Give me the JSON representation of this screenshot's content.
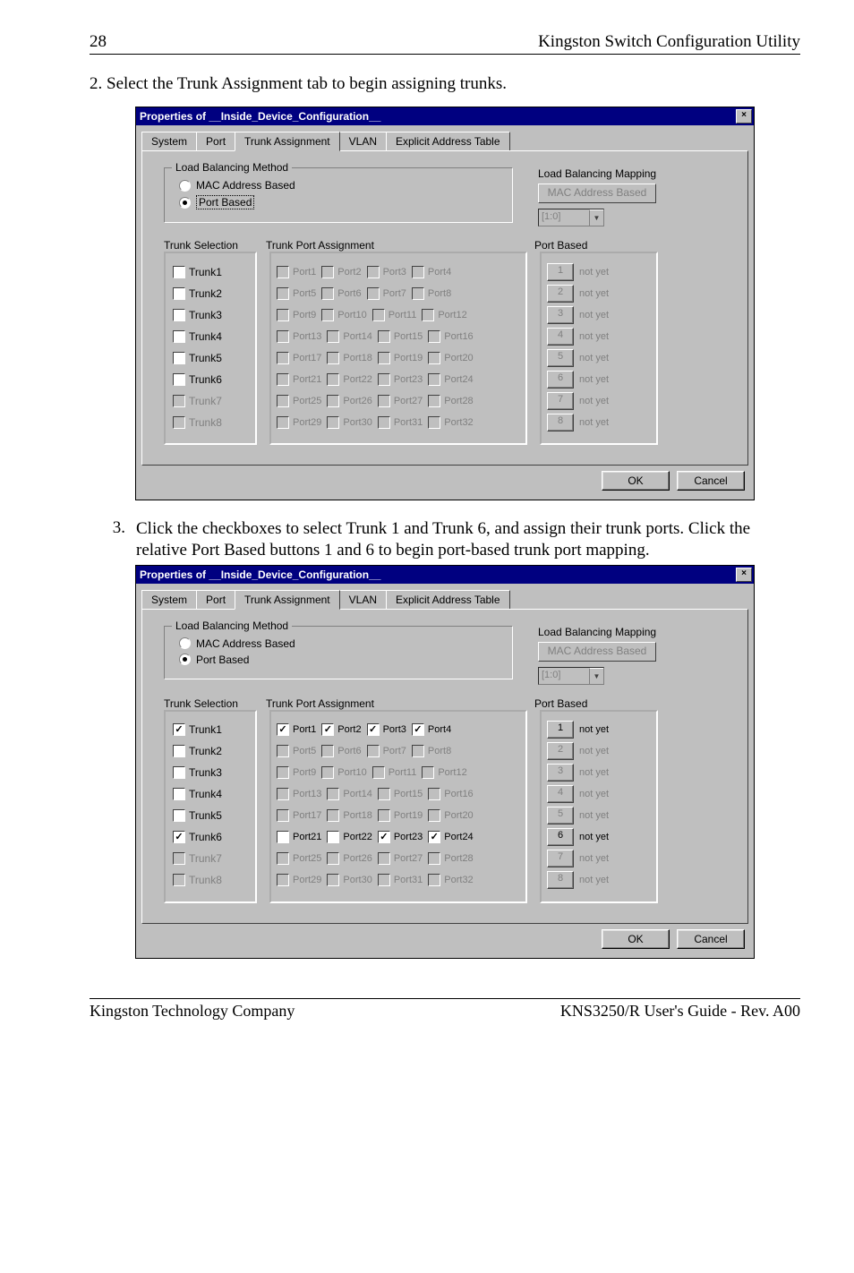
{
  "header": {
    "page_num": "28",
    "title": "Kingston Switch Configuration Utility"
  },
  "steps": {
    "s2": "2. Select the Trunk Assignment tab to begin assigning trunks.",
    "s3": "Click the checkboxes to select Trunk 1 and Trunk 6, and assign their trunk ports. Click the relative Port Based buttons 1 and 6 to begin port-based trunk port mapping.",
    "s3num": "3."
  },
  "dialog": {
    "title": "Properties of __Inside_Device_Configuration__",
    "close": "×",
    "tabs": {
      "system": "System",
      "port": "Port",
      "trunk": "Trunk Assignment",
      "vlan": "VLAN",
      "explicit": "Explicit Address Table"
    },
    "lb_group": "Load Balancing Method",
    "mac_radio": "MAC Address Based",
    "port_radio": "Port Based",
    "map_title": "Load Balancing Mapping",
    "mac_btn": "MAC Address Based",
    "combo_val": "[1:0]",
    "trunk_sel": "Trunk Selection",
    "tpa": "Trunk Port Assignment",
    "port_based_hdr": "Port Based",
    "not_yet": "not yet",
    "trunks": [
      "Trunk1",
      "Trunk2",
      "Trunk3",
      "Trunk4",
      "Trunk5",
      "Trunk6",
      "Trunk7",
      "Trunk8"
    ],
    "ports": [
      [
        "Port1",
        "Port2",
        "Port3",
        "Port4"
      ],
      [
        "Port5",
        "Port6",
        "Port7",
        "Port8"
      ],
      [
        "Port9",
        "Port10",
        "Port11",
        "Port12"
      ],
      [
        "Port13",
        "Port14",
        "Port15",
        "Port16"
      ],
      [
        "Port17",
        "Port18",
        "Port19",
        "Port20"
      ],
      [
        "Port21",
        "Port22",
        "Port23",
        "Port24"
      ],
      [
        "Port25",
        "Port26",
        "Port27",
        "Port28"
      ],
      [
        "Port29",
        "Port30",
        "Port31",
        "Port32"
      ]
    ],
    "pb_nums": [
      "1",
      "2",
      "3",
      "4",
      "5",
      "6",
      "7",
      "8"
    ],
    "ok": "OK",
    "cancel": "Cancel"
  },
  "d1": {
    "trunk_enabled": [
      true,
      true,
      true,
      true,
      true,
      true,
      false,
      false
    ],
    "trunk_checked": [
      false,
      false,
      false,
      false,
      false,
      false,
      false,
      false
    ],
    "port_checked": [
      [
        false,
        false,
        false,
        false
      ],
      [
        false,
        false,
        false,
        false
      ],
      [
        false,
        false,
        false,
        false
      ],
      [
        false,
        false,
        false,
        false
      ],
      [
        false,
        false,
        false,
        false
      ],
      [
        false,
        false,
        false,
        false
      ],
      [
        false,
        false,
        false,
        false
      ],
      [
        false,
        false,
        false,
        false
      ]
    ],
    "port_enabled_row": [
      false,
      false,
      false,
      false,
      false,
      false,
      false,
      false
    ],
    "pb_enabled": [
      false,
      false,
      false,
      false,
      false,
      false,
      false,
      false
    ]
  },
  "d2": {
    "trunk_enabled": [
      true,
      true,
      true,
      true,
      true,
      true,
      false,
      false
    ],
    "trunk_checked": [
      true,
      false,
      false,
      false,
      false,
      true,
      false,
      false
    ],
    "port_checked": [
      [
        true,
        true,
        true,
        true
      ],
      [
        false,
        false,
        false,
        false
      ],
      [
        false,
        false,
        false,
        false
      ],
      [
        false,
        false,
        false,
        false
      ],
      [
        false,
        false,
        false,
        false
      ],
      [
        false,
        false,
        true,
        true
      ],
      [
        false,
        false,
        false,
        false
      ],
      [
        false,
        false,
        false,
        false
      ]
    ],
    "port_enabled_row": [
      true,
      false,
      false,
      false,
      false,
      true,
      false,
      false
    ],
    "pb_enabled": [
      true,
      false,
      false,
      false,
      false,
      true,
      false,
      false
    ]
  },
  "footer": {
    "left": "Kingston Technology Company",
    "right": "KNS3250/R User's Guide - Rev. A00"
  }
}
